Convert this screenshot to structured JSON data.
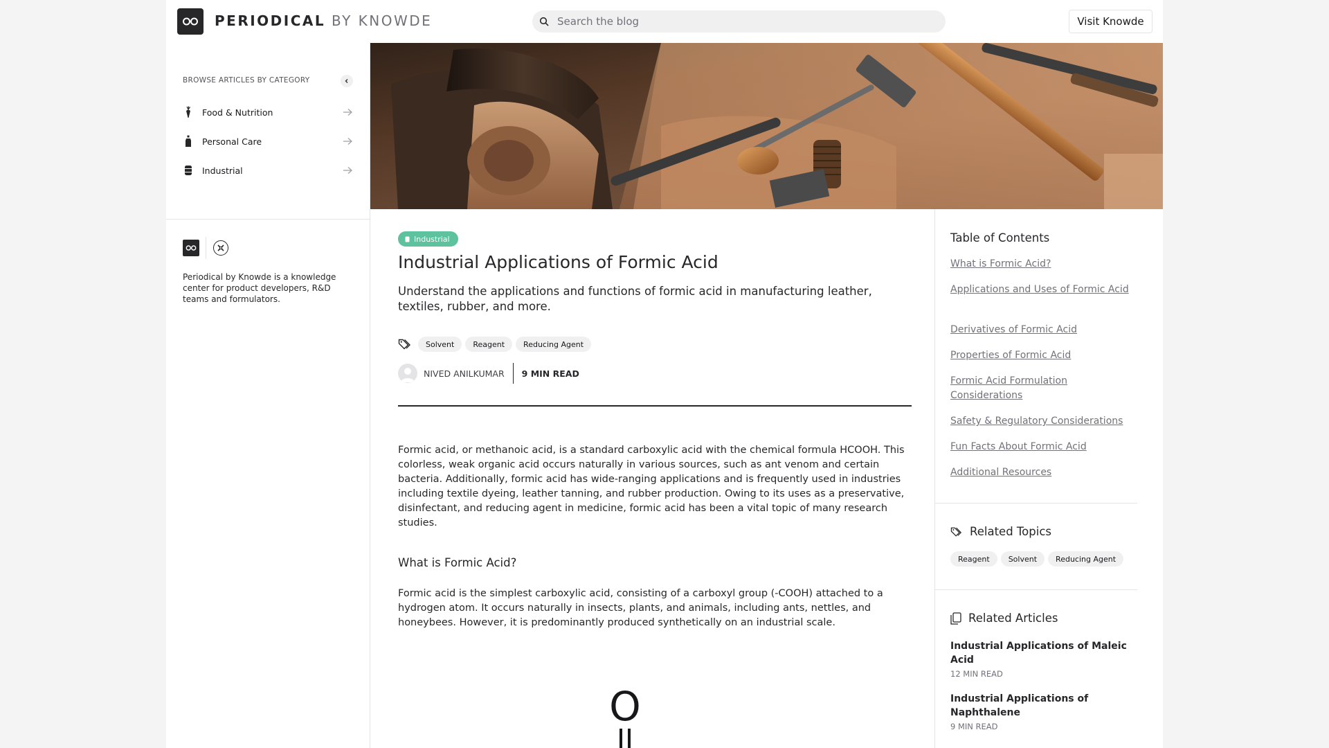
{
  "header": {
    "brand_primary": "PERIODICAL",
    "brand_secondary": "BY KNOWDE",
    "search_placeholder": "Search the blog",
    "visit_button": "Visit Knowde"
  },
  "sidebar": {
    "browse_title": "BROWSE ARTICLES BY CATEGORY",
    "categories": [
      {
        "label": "Food & Nutrition",
        "icon": "carrot-icon"
      },
      {
        "label": "Personal Care",
        "icon": "bottle-icon"
      },
      {
        "label": "Industrial",
        "icon": "barrel-icon"
      }
    ],
    "about": "Periodical by Knowde is a knowledge center for product developers, R&D teams and formulators."
  },
  "article": {
    "category_chip": "Industrial",
    "title": "Industrial Applications of Formic Acid",
    "subtitle": "Understand the applications and functions of formic acid in manufacturing leather, textiles, rubber, and more.",
    "tags": [
      "Solvent",
      "Reagent",
      "Reducing Agent"
    ],
    "author": "NIVED ANILKUMAR",
    "read_time": "9 MIN READ",
    "intro": "Formic acid, or methanoic acid, is a standard carboxylic acid with the chemical formula HCOOH. This colorless, weak organic acid occurs naturally in various sources, such as ant venom and certain bacteria. Additionally, formic acid has wide-ranging applications and is frequently used in industries including textile dyeing, leather tanning, and rubber production. Owing to its uses as a preservative, disinfectant, and reducing agent in medicine, formic acid has been a vital topic of many research studies.",
    "section1_heading": "What is Formic Acid?",
    "section1_body": "Formic acid is the simplest carboxylic acid, consisting of a carboxyl group (-COOH) attached to a hydrogen atom. It occurs naturally in insects, plants, and animals, including ants, nettles, and honeybees. However, it is predominantly produced synthetically on an industrial scale.",
    "molecule_label": "O"
  },
  "toc": {
    "title": "Table of Contents",
    "items": [
      "What is Formic Acid?",
      "Applications and Uses of Formic Acid",
      "Derivatives of Formic Acid",
      "Properties of Formic Acid",
      "Formic Acid Formulation Considerations",
      "Safety & Regulatory Considerations",
      "Fun Facts About Formic Acid",
      "Additional Resources"
    ]
  },
  "related_topics": {
    "title": "Related Topics",
    "tags": [
      "Reagent",
      "Solvent",
      "Reducing Agent"
    ]
  },
  "related_articles": {
    "title": "Related Articles",
    "items": [
      {
        "title": "Industrial Applications of Maleic Acid",
        "read_time": "12 MIN READ"
      },
      {
        "title": "Industrial Applications of Naphthalene",
        "read_time": "9 MIN READ"
      }
    ]
  },
  "colors": {
    "accent_green": "#5fc29e",
    "text_dark": "#27272a",
    "muted": "#71717a"
  }
}
